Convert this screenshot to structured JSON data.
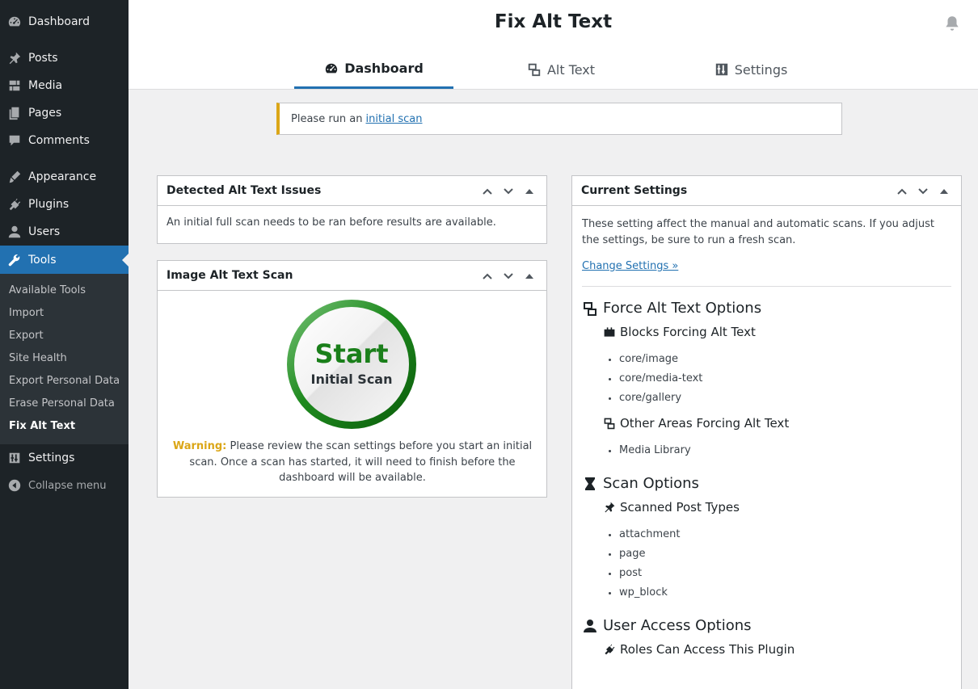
{
  "sidebar": {
    "items": [
      {
        "label": "Dashboard",
        "icon": "dashboard-icon"
      },
      {
        "label": "Posts",
        "icon": "pin-icon"
      },
      {
        "label": "Media",
        "icon": "media-icon"
      },
      {
        "label": "Pages",
        "icon": "pages-icon"
      },
      {
        "label": "Comments",
        "icon": "comments-icon"
      },
      {
        "label": "Appearance",
        "icon": "appearance-icon"
      },
      {
        "label": "Plugins",
        "icon": "plugins-icon"
      },
      {
        "label": "Users",
        "icon": "users-icon"
      },
      {
        "label": "Tools",
        "icon": "wrench-icon"
      },
      {
        "label": "Settings",
        "icon": "settings-icon"
      },
      {
        "label": "Collapse menu",
        "icon": "collapse-icon"
      }
    ],
    "submenu": [
      "Available Tools",
      "Import",
      "Export",
      "Site Health",
      "Export Personal Data",
      "Erase Personal Data",
      "Fix Alt Text"
    ]
  },
  "header": {
    "title": "Fix Alt Text",
    "tabs": [
      {
        "label": "Dashboard",
        "icon": "gauge-icon"
      },
      {
        "label": "Alt Text",
        "icon": "images-icon"
      },
      {
        "label": "Settings",
        "icon": "sliders-icon"
      }
    ]
  },
  "notice": {
    "text": "Please run an",
    "link": "initial scan"
  },
  "issues_box": {
    "title": "Detected Alt Text Issues",
    "body": "An initial full scan needs to be ran before results are available."
  },
  "scan_box": {
    "title": "Image Alt Text Scan",
    "start_big": "Start",
    "start_small": "Initial Scan",
    "warning_label": "Warning:",
    "warning_text": "Please review the scan settings before you start an initial scan. Once a scan has started, it will need to finish before the dashboard will be available."
  },
  "settings_box": {
    "title": "Current Settings",
    "intro": "These setting affect the manual and automatic scans. If you adjust the settings, be sure to run a fresh scan.",
    "change_link": "Change Settings »",
    "force_heading": "Force Alt Text Options",
    "blocks_heading": "Blocks Forcing Alt Text",
    "blocks": [
      "core/image",
      "core/media-text",
      "core/gallery"
    ],
    "other_heading": "Other Areas Forcing Alt Text",
    "other": [
      "Media Library"
    ],
    "scan_heading": "Scan Options",
    "post_types_heading": "Scanned Post Types",
    "post_types": [
      "attachment",
      "page",
      "post",
      "wp_block"
    ],
    "access_heading": "User Access Options",
    "roles_heading": "Roles Can Access This Plugin"
  },
  "colors": {
    "accent": "#2271b1",
    "sidebar": "#1d2327",
    "warning": "#dba617",
    "start_green": "#1a7f1a"
  }
}
